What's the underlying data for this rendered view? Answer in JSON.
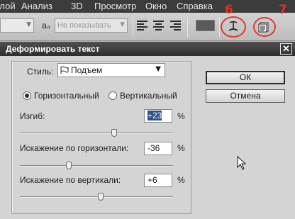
{
  "menubar": {
    "items": [
      {
        "label": "Слой"
      },
      {
        "label": "Анализ"
      },
      {
        "label": "3D"
      },
      {
        "label": "Просмотр"
      },
      {
        "label": "Окно"
      },
      {
        "label": "Справка"
      }
    ]
  },
  "toolbar": {
    "font_style_placeholder": "",
    "aa_icon_label": "aₐ",
    "antialias_value": "Не показывать",
    "align_left_icon": "align-left-icon",
    "align_center_icon": "align-center-icon",
    "align_right_icon": "align-right-icon",
    "color_swatch": "#5a5a5a",
    "warp_icon": "warp-text-icon",
    "panels_icon": "char-paragraph-panels-icon",
    "annotation_6": "6",
    "annotation_7": "7",
    "annotation_color": "#e0301e"
  },
  "dialog": {
    "title": "Деформировать текст",
    "close_label": "✕",
    "style_label": "Стиль:",
    "style_value": "Подъем",
    "orientation": {
      "horizontal_label": "Горизонтальный",
      "vertical_label": "Вертикальный",
      "selected": "horizontal"
    },
    "bend": {
      "label": "Изгиб:",
      "value": "+23",
      "unit": "%",
      "slider_percent": 23
    },
    "hdist": {
      "label": "Искажение по горизонтали:",
      "value": "-36",
      "unit": "%",
      "slider_percent": -36
    },
    "vdist": {
      "label": "Искажение по вертикали:",
      "value": "+6",
      "unit": "%",
      "slider_percent": 6
    },
    "ok_label": "ОК",
    "cancel_label": "Отмена"
  }
}
